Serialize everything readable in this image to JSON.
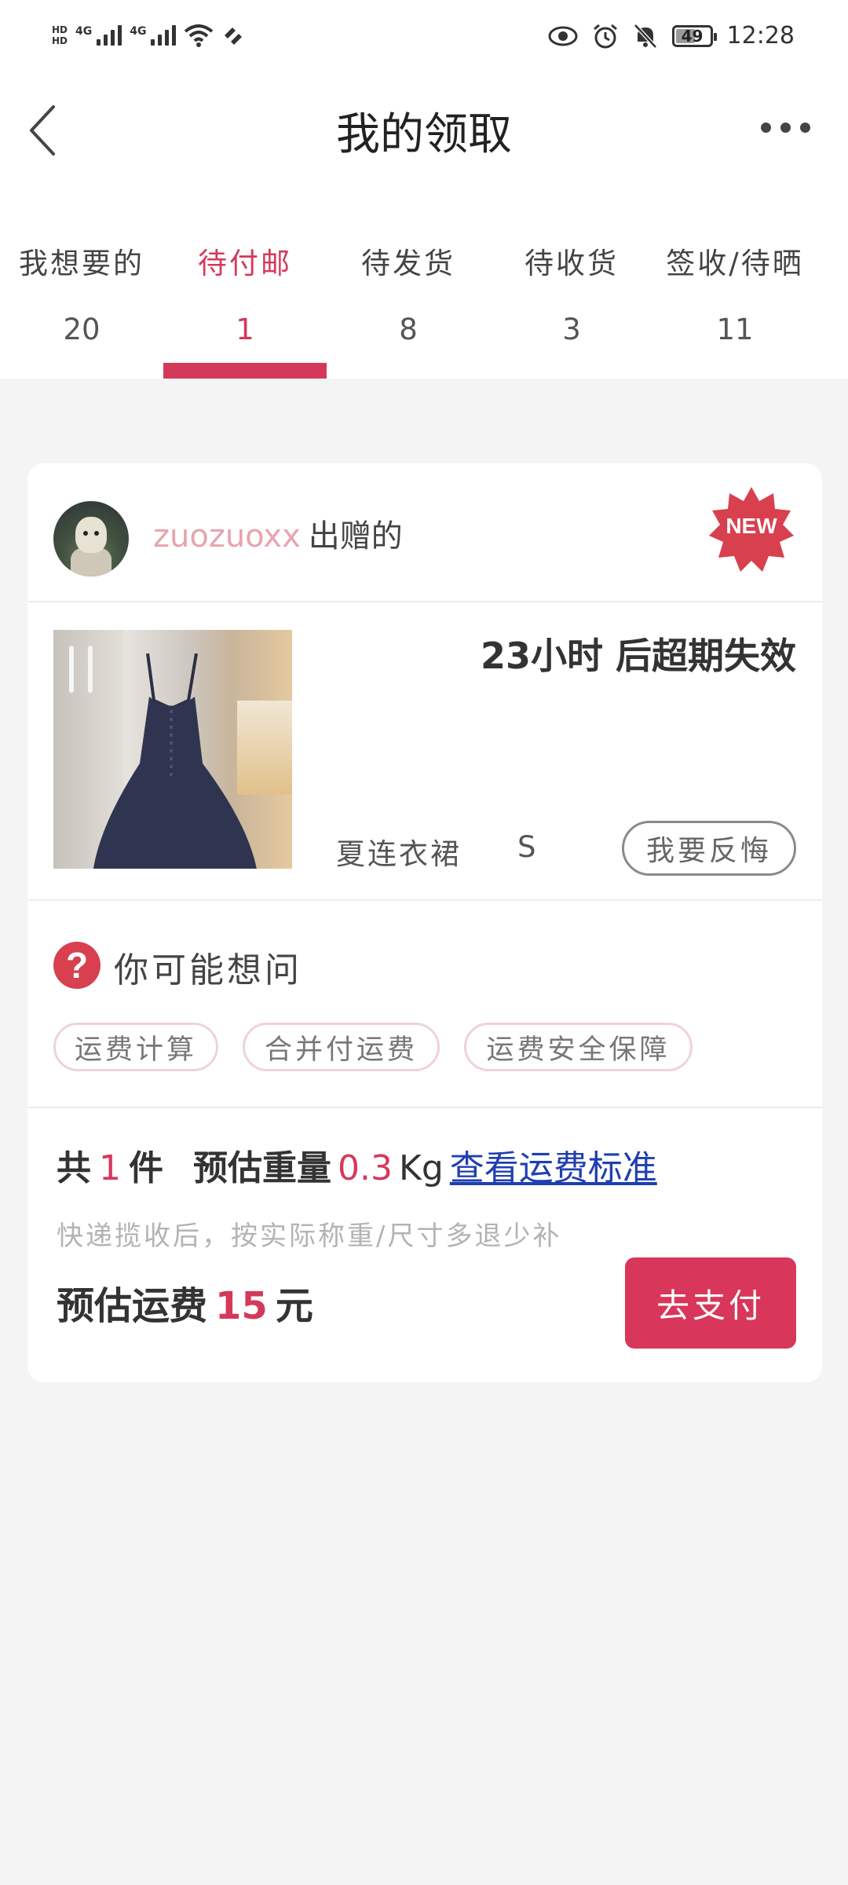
{
  "status_bar": {
    "hd1": "HD",
    "hd2": "HD",
    "net1": "4G",
    "net2": "4G",
    "battery": "49",
    "time": "12:28",
    "icons": [
      "eye-icon",
      "alarm-icon",
      "mute-bell-icon"
    ]
  },
  "header": {
    "title": "我的领取"
  },
  "tabs": [
    {
      "label": "我想要的",
      "count": "20"
    },
    {
      "label": "待付邮",
      "count": "1"
    },
    {
      "label": "待发货",
      "count": "8"
    },
    {
      "label": "待收货",
      "count": "3"
    },
    {
      "label": "签收/待晒",
      "count": "11"
    }
  ],
  "active_tab_index": 1,
  "colors": {
    "accent": "#d4395a",
    "link": "#1f3fb0",
    "background": "#f4f4f4"
  },
  "card": {
    "giver_name": "zuozuoxx",
    "giver_suffix": "出赠的",
    "badge": "NEW",
    "expire_text": "23小时 后超期失效",
    "item_name": "夏连衣裙",
    "item_size": "S",
    "regret_label": "我要反悔",
    "faq_title": "你可能想问",
    "faq_chips": [
      "运费计算",
      "合并付运费",
      "运费安全保障"
    ],
    "summary": {
      "count_prefix": "共",
      "count": "1",
      "count_suffix": "件",
      "weight_label": "预估重量",
      "weight_value": "0.3",
      "weight_unit": "Kg",
      "link_label": "查看运费标准",
      "note": "快递揽收后，按实际称重/尺寸多退少补",
      "fee_label": "预估运费",
      "fee_value": "15",
      "fee_unit": "元",
      "pay_label": "去支付"
    }
  }
}
